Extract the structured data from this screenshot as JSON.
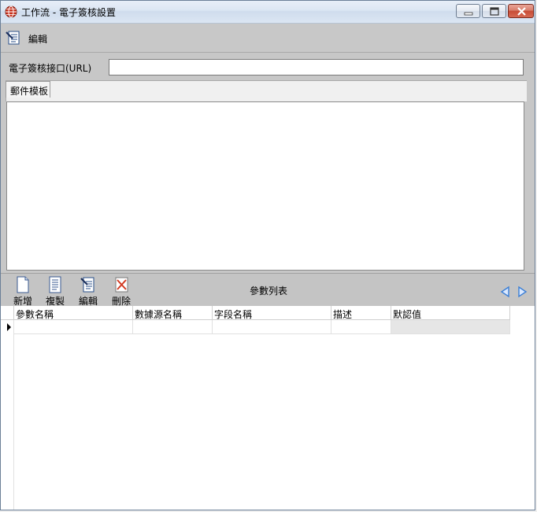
{
  "window": {
    "title": "工作流 - 電子簽核設置",
    "icon": "globe-icon"
  },
  "toolbar": {
    "edit_label": "編輯",
    "edit_icon": "document-edit-icon"
  },
  "url_field": {
    "label": "電子簽核接口(URL)",
    "value": ""
  },
  "tabs": [
    {
      "label": "郵件模板",
      "active": true
    }
  ],
  "template_text": "",
  "param_toolbar": {
    "title": "參數列表",
    "buttons": [
      {
        "label": "新增",
        "icon": "new-document-icon"
      },
      {
        "label": "複製",
        "icon": "copy-document-icon"
      },
      {
        "label": "編輯",
        "icon": "document-edit-icon"
      },
      {
        "label": "刪除",
        "icon": "delete-icon"
      }
    ]
  },
  "grid": {
    "columns": [
      "參數名稱",
      "數據源名稱",
      "字段名稱",
      "描述",
      "默認值"
    ],
    "rows": [
      [
        "",
        "",
        "",
        "",
        ""
      ]
    ]
  },
  "colors": {
    "background": "#c7c7c7",
    "delete_icon": "#d23a22",
    "nav_arrow": "#3b7fd6"
  }
}
